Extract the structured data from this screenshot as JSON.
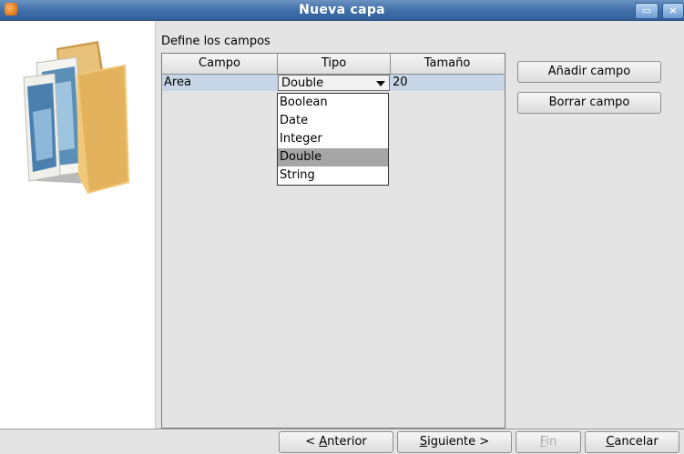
{
  "window": {
    "title": "Nueva capa"
  },
  "section": {
    "label": "Define los campos"
  },
  "table": {
    "headers": [
      "Campo",
      "Tipo",
      "Tamaño"
    ],
    "rows": [
      {
        "campo": "Area",
        "tipo": "Double",
        "tamano": "20"
      }
    ]
  },
  "type_dropdown": {
    "options": [
      "Boolean",
      "Date",
      "Integer",
      "Double",
      "String"
    ],
    "selected": "Double"
  },
  "buttons": {
    "add_field": "Añadir campo",
    "remove_field": "Borrar campo",
    "previous_mnemonic": "A",
    "previous_prefix": "< ",
    "previous_rest": "nterior",
    "next_mnemonic": "S",
    "next_rest": "iguiente >",
    "finish_mnemonic": "F",
    "finish_rest": "in",
    "cancel_mnemonic": "C",
    "cancel_rest": "ancelar"
  },
  "icons": {
    "app": "app-icon",
    "minimize": "minimize-icon",
    "close": "close-icon",
    "wizard": "folder-images-icon",
    "combo_arrow": "triangle-down-icon"
  }
}
